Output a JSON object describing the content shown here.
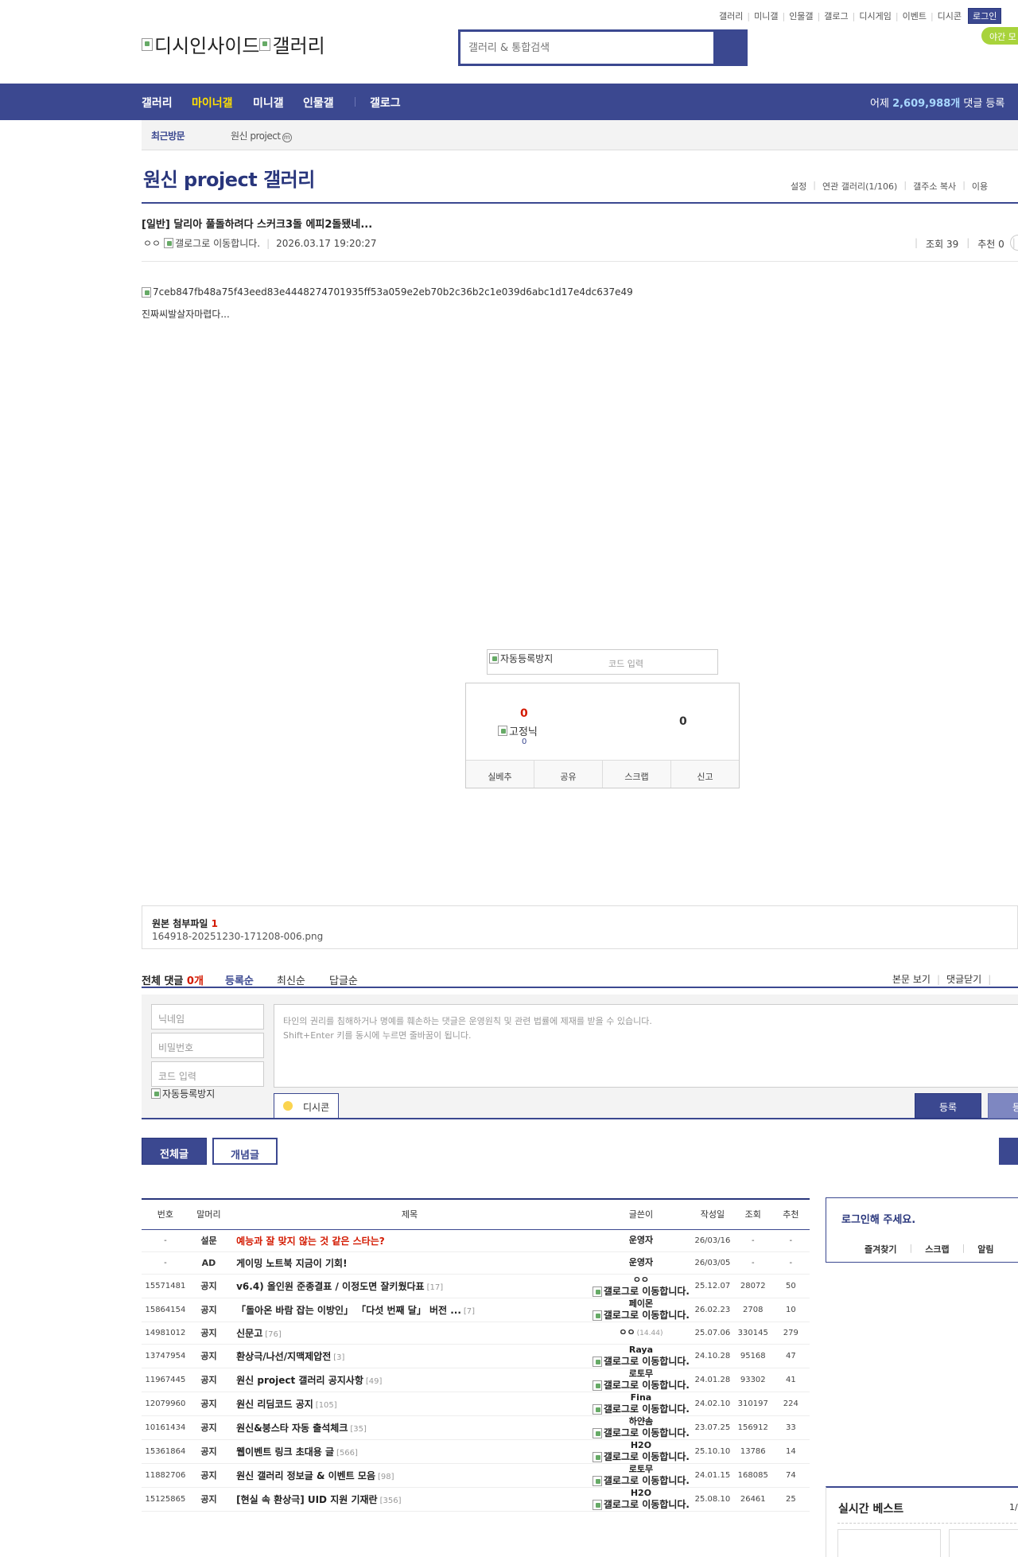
{
  "top_links": [
    "갤러리",
    "미니갤",
    "인물갤",
    "갤로그",
    "디시게임",
    "이벤트",
    "디시콘"
  ],
  "login_label": "로그인",
  "night_mode": "야간 모",
  "logo": {
    "alt1": "디시인사이드",
    "alt2": "갤러리"
  },
  "search": {
    "placeholder": "갤러리 & 통합검색"
  },
  "nav": {
    "items": [
      "갤러리",
      "마이너갤",
      "미니갤",
      "인물갤",
      "갤로그"
    ],
    "stat_prefix": "어제",
    "stat_num": "2,609,988개",
    "stat_suffix": "댓글 등록"
  },
  "recent": {
    "label": "최근방문",
    "item": "원신 project",
    "badge": "m"
  },
  "gallery": {
    "title": "원신 project 갤러리",
    "links": [
      "설정",
      "연관 갤러리(1/106)",
      "갤주소 복사",
      "이용"
    ]
  },
  "post": {
    "title": "[일반] 달리아 풀돌하려다 스커크3돌 에피2돌됐네...",
    "author": "ㅇㅇ",
    "gallog_alt": "갤로그로 이동합니다.",
    "date": "2026.03.17 19:20:27",
    "views": "조회 39",
    "recommend": "추천 0",
    "image_alt": "7ceb847fb48a75f43eed83e4448274701935ff53a059e2eb70b2c36b2c1e039d6abc1d17e4dc637e49",
    "body": "진짜씨발살자마렵다..."
  },
  "captcha": {
    "alt": "자동등록방지",
    "placeholder": "코드 입력"
  },
  "vote": {
    "up": "0",
    "fix_alt": "고정닉",
    "fix_count": "0",
    "down": "0",
    "actions": [
      "실베추",
      "공유",
      "스크랩",
      "신고"
    ]
  },
  "attach": {
    "label": "원본 첨부파일",
    "count": "1",
    "file": "164918-20251230-171208-006.png"
  },
  "comments": {
    "total_label": "전체 댓글",
    "total_count": "0개",
    "sorts": [
      "등록순",
      "최신순",
      "답글순"
    ],
    "right_links": [
      "본문 보기",
      "댓글닫기"
    ],
    "nick_placeholder": "닉네임",
    "pw_placeholder": "비밀번호",
    "code_placeholder": "코드 입력",
    "captcha_alt": "자동등록방지",
    "textarea_line1": "타인의 권리를 침해하거나 명예를 훼손하는 댓글은 운영원칙 및 관련 법률에 제재를 받을 수 있습니다.",
    "textarea_line2": "Shift+Enter 키를 동시에 누르면 줄바꿈이 됩니다.",
    "dccon": "디시콘",
    "submit": "등록",
    "submit2": "등록"
  },
  "list_tabs": {
    "all": "전체글",
    "concept": "개념글"
  },
  "table": {
    "headers": [
      "번호",
      "말머리",
      "제목",
      "글쓴이",
      "작성일",
      "조회",
      "추천"
    ],
    "rows": [
      {
        "no": "-",
        "head": "설문",
        "subject": "예능과 잘 맞지 않는 것 같은 스타는?",
        "reply": "",
        "writer": "운영자",
        "gallog": false,
        "ip": "",
        "date": "26/03/16",
        "views": "-",
        "rec": "-",
        "red": true
      },
      {
        "no": "-",
        "head": "AD",
        "subject": "게이밍 노트북 지금이 기회!",
        "reply": "",
        "writer": "운영자",
        "gallog": false,
        "ip": "",
        "date": "26/03/05",
        "views": "-",
        "rec": "-",
        "red": false
      },
      {
        "no": "15571481",
        "head": "공지",
        "subject": "v6.4) 올인원 준종결표 / 이정도면 잘키웠다표",
        "reply": "[17]",
        "writer": "ㅇㅇ",
        "gallog": true,
        "ip": "",
        "date": "25.12.07",
        "views": "28072",
        "rec": "50",
        "red": false
      },
      {
        "no": "15864154",
        "head": "공지",
        "subject": "「돌아온 바람 잡는 이방인」 「다섯 번째 달」 버전 ...",
        "reply": "[7]",
        "writer": "페이몬",
        "gallog": true,
        "ip": "",
        "date": "26.02.23",
        "views": "2708",
        "rec": "10",
        "red": false
      },
      {
        "no": "14981012",
        "head": "공지",
        "subject": "신문고",
        "reply": "[76]",
        "writer": "ㅇㅇ",
        "gallog": false,
        "ip": "(14.44)",
        "date": "25.07.06",
        "views": "330145",
        "rec": "279",
        "red": false
      },
      {
        "no": "13747954",
        "head": "공지",
        "subject": "환상극/나선/지맥제압전",
        "reply": "[3]",
        "writer": "Raya",
        "gallog": true,
        "ip": "",
        "date": "24.10.28",
        "views": "95168",
        "rec": "47",
        "red": false
      },
      {
        "no": "11967445",
        "head": "공지",
        "subject": "원신 project 갤러리 공지사항",
        "reply": "[49]",
        "writer": "로토무",
        "gallog": true,
        "ip": "",
        "date": "24.01.28",
        "views": "93302",
        "rec": "41",
        "red": false
      },
      {
        "no": "12079960",
        "head": "공지",
        "subject": "원신 리딤코드 공지",
        "reply": "[105]",
        "writer": "Fina",
        "gallog": true,
        "ip": "",
        "date": "24.02.10",
        "views": "310197",
        "rec": "224",
        "red": false
      },
      {
        "no": "10161434",
        "head": "공지",
        "subject": "원신&붕스타 자동 출석체크",
        "reply": "[35]",
        "writer": "하얀솜",
        "gallog": true,
        "ip": "",
        "date": "23.07.25",
        "views": "156912",
        "rec": "33",
        "red": false
      },
      {
        "no": "15361864",
        "head": "공지",
        "subject": "웹이벤트 링크 초대용 글",
        "reply": "[566]",
        "writer": "H2O",
        "gallog": true,
        "ip": "",
        "date": "25.10.10",
        "views": "13786",
        "rec": "14",
        "red": false
      },
      {
        "no": "11882706",
        "head": "공지",
        "subject": "원신 갤러리 정보글 & 이벤트 모음",
        "reply": "[98]",
        "writer": "로토무",
        "gallog": true,
        "ip": "",
        "date": "24.01.15",
        "views": "168085",
        "rec": "74",
        "red": false
      },
      {
        "no": "15125865",
        "head": "공지",
        "subject": "[현실 속 환상극] UID 지원 기재란",
        "reply": "[356]",
        "writer": "H2O",
        "gallog": true,
        "ip": "",
        "date": "25.08.10",
        "views": "26461",
        "rec": "25",
        "red": false
      }
    ]
  },
  "side": {
    "login_title": "로그인해 주세요.",
    "login_links": [
      "즐겨찾기",
      "스크랩",
      "알림"
    ],
    "best_title": "실시간 베스트",
    "best_page": "1/"
  },
  "colors": {
    "brand": "#3b4890",
    "brand_dark": "#29367c",
    "accent_yellow": "#fedf00",
    "alert_red": "#d31900"
  }
}
